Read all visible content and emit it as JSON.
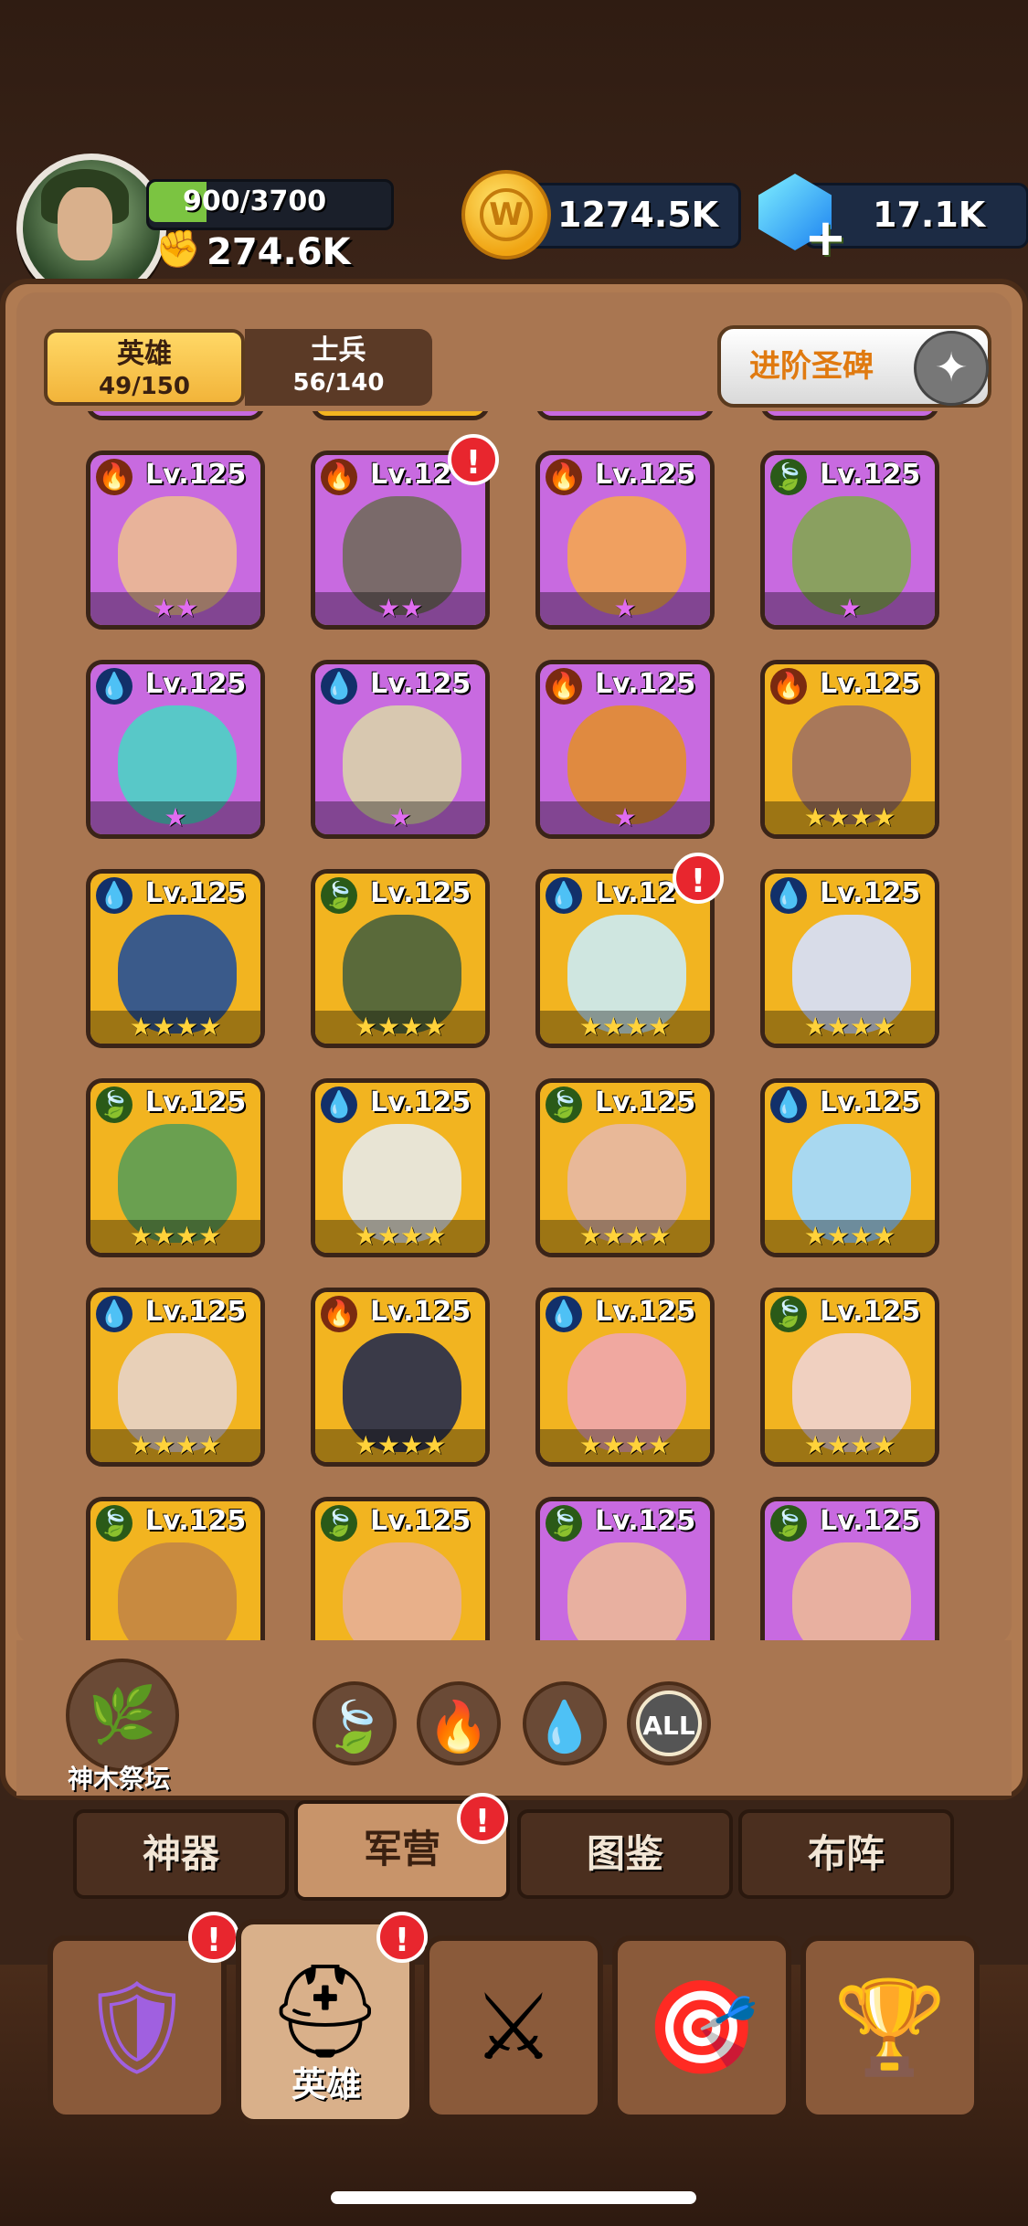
{
  "player": {
    "xp": "900/3700",
    "xp_fraction": 0.24,
    "power": "274.6K"
  },
  "resources": {
    "gold": "1274.5K",
    "gems": "17.1K",
    "gold_icon": "coin-icon",
    "gem_icon": "gem-icon"
  },
  "tabs": {
    "hero": {
      "label": "英雄",
      "count": "49/150"
    },
    "soldier": {
      "label": "士兵",
      "count": "56/140"
    }
  },
  "stele_button": "进阶圣碑",
  "heroes": [
    {
      "level": "Lv.125",
      "element": "fire",
      "stars": 2,
      "star_color": "pink",
      "bg": "#c86ae0",
      "skin": "#e8b39a",
      "badge": false
    },
    {
      "level": "Lv.12",
      "element": "fire",
      "stars": 2,
      "star_color": "pink",
      "bg": "#c86ae0",
      "skin": "#7a6a6a",
      "badge": true
    },
    {
      "level": "Lv.125",
      "element": "fire",
      "stars": 1,
      "star_color": "pink",
      "bg": "#c86ae0",
      "skin": "#f0a060",
      "badge": false
    },
    {
      "level": "Lv.125",
      "element": "leaf",
      "stars": 1,
      "star_color": "pink",
      "bg": "#c86ae0",
      "skin": "#8aa060",
      "badge": false
    },
    {
      "level": "Lv.125",
      "element": "water",
      "stars": 1,
      "star_color": "pink",
      "bg": "#c86ae0",
      "skin": "#58c8c8",
      "badge": false
    },
    {
      "level": "Lv.125",
      "element": "water",
      "stars": 1,
      "star_color": "pink",
      "bg": "#c86ae0",
      "skin": "#d8c8b0",
      "badge": false
    },
    {
      "level": "Lv.125",
      "element": "fire",
      "stars": 1,
      "star_color": "pink",
      "bg": "#c86ae0",
      "skin": "#e08a40",
      "badge": false
    },
    {
      "level": "Lv.125",
      "element": "fire",
      "stars": 4,
      "star_color": "gold",
      "bg": "#f2b420",
      "skin": "#a8785a",
      "badge": false
    },
    {
      "level": "Lv.125",
      "element": "water",
      "stars": 4,
      "star_color": "gold",
      "bg": "#f2b420",
      "skin": "#3a5a8a",
      "badge": false
    },
    {
      "level": "Lv.125",
      "element": "leaf",
      "stars": 4,
      "star_color": "gold",
      "bg": "#f2b420",
      "skin": "#5a6a3a",
      "badge": false
    },
    {
      "level": "Lv.12",
      "element": "water",
      "stars": 4,
      "star_color": "gold",
      "bg": "#f2b420",
      "skin": "#cfe6e0",
      "badge": true
    },
    {
      "level": "Lv.125",
      "element": "water",
      "stars": 4,
      "star_color": "gold",
      "bg": "#f2b420",
      "skin": "#d8dce8",
      "badge": false
    },
    {
      "level": "Lv.125",
      "element": "leaf",
      "stars": 4,
      "star_color": "gold",
      "bg": "#f2b420",
      "skin": "#6aa050",
      "badge": false
    },
    {
      "level": "Lv.125",
      "element": "water",
      "stars": 4,
      "star_color": "gold",
      "bg": "#f2b420",
      "skin": "#e8e4d4",
      "badge": false
    },
    {
      "level": "Lv.125",
      "element": "leaf",
      "stars": 4,
      "star_color": "gold",
      "bg": "#f2b420",
      "skin": "#e8b898",
      "badge": false
    },
    {
      "level": "Lv.125",
      "element": "water",
      "stars": 4,
      "star_color": "gold",
      "bg": "#f2b420",
      "skin": "#a8d8f0",
      "badge": false
    },
    {
      "level": "Lv.125",
      "element": "water",
      "stars": 4,
      "star_color": "gold",
      "bg": "#f2b420",
      "skin": "#e8d0b8",
      "badge": false
    },
    {
      "level": "Lv.125",
      "element": "fire",
      "stars": 4,
      "star_color": "gold",
      "bg": "#f2b420",
      "skin": "#3a3a48",
      "badge": false
    },
    {
      "level": "Lv.125",
      "element": "water",
      "stars": 4,
      "star_color": "gold",
      "bg": "#f2b420",
      "skin": "#f0a8a0",
      "badge": false
    },
    {
      "level": "Lv.125",
      "element": "leaf",
      "stars": 4,
      "star_color": "gold",
      "bg": "#f2b420",
      "skin": "#f0d0c0",
      "badge": false
    },
    {
      "level": "Lv.125",
      "element": "leaf",
      "stars": 0,
      "star_color": "gold",
      "bg": "#f2b420",
      "skin": "#c88a40",
      "badge": false
    },
    {
      "level": "Lv.125",
      "element": "leaf",
      "stars": 0,
      "star_color": "gold",
      "bg": "#f2b420",
      "skin": "#e8b08a",
      "badge": false
    },
    {
      "level": "Lv.125",
      "element": "leaf",
      "stars": 0,
      "star_color": "gold",
      "bg": "#c86ae0",
      "skin": "#e8b0a0",
      "badge": false
    },
    {
      "level": "Lv.125",
      "element": "leaf",
      "stars": 0,
      "star_color": "gold",
      "bg": "#c86ae0",
      "skin": "#e8b0a0",
      "badge": false
    }
  ],
  "altar_label": "神木祭坛",
  "filters": {
    "all_label": "ALL"
  },
  "sub_tabs": [
    "神器",
    "军营",
    "图鉴",
    "布阵"
  ],
  "nav": {
    "hero_label": "英雄"
  },
  "badge_mark": "!"
}
